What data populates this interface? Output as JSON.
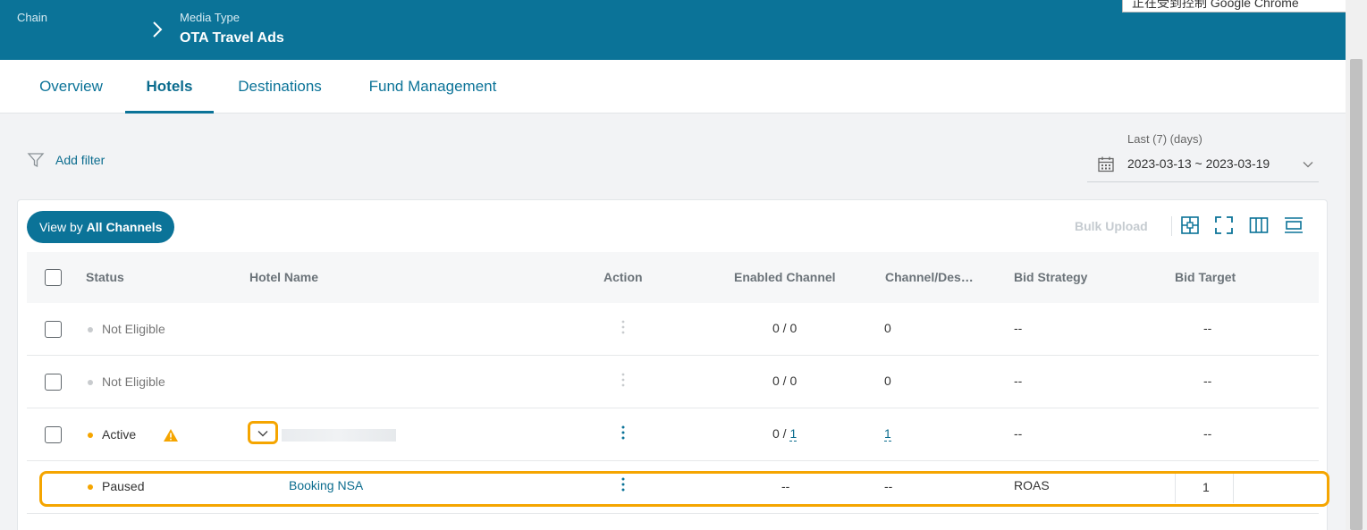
{
  "header": {
    "breadcrumb_root": "Chain",
    "media_type_label": "Media Type",
    "media_type_value": "OTA Travel Ads",
    "chrome_banner": "正在受到控制 Google Chrome"
  },
  "tabs": [
    {
      "label": "Overview",
      "active": false
    },
    {
      "label": "Hotels",
      "active": true
    },
    {
      "label": "Destinations",
      "active": false
    },
    {
      "label": "Fund Management",
      "active": false
    }
  ],
  "filter": {
    "add_filter_label": "Add filter"
  },
  "date": {
    "caption": "Last (7) (days)",
    "range": "2023-03-13 ~ 2023-03-19"
  },
  "toolbar": {
    "view_prefix": "View by ",
    "view_value": "All Channels",
    "bulk_upload": "Bulk Upload",
    "icons": [
      "expand-rows-icon",
      "fullscreen-icon",
      "columns-icon",
      "row-height-icon"
    ]
  },
  "table": {
    "columns": [
      "Status",
      "Hotel Name",
      "Action",
      "Enabled Channel",
      "Channel/Des…",
      "Bid Strategy",
      "Bid Target"
    ],
    "rows": [
      {
        "status": "Not Eligible",
        "hotel": "",
        "enabled": "0 / 0",
        "channel": "0",
        "strategy": "--",
        "target": "--"
      },
      {
        "status": "Not Eligible",
        "hotel": "",
        "enabled": "0 / 0",
        "channel": "0",
        "strategy": "--",
        "target": "--"
      },
      {
        "status": "Active",
        "hotel": "",
        "enabled_prefix": "0 / ",
        "enabled_link": "1",
        "channel": "1",
        "strategy": "--",
        "target": "--"
      },
      {
        "status": "Paused",
        "hotel": "Booking NSA",
        "enabled": "--",
        "channel": "--",
        "strategy": "ROAS",
        "target": "1"
      }
    ]
  },
  "colors": {
    "brand": "#0b7398",
    "active_status": "#f5a500",
    "inactive_status": "#c8cbce",
    "highlight": "#f5a500"
  }
}
